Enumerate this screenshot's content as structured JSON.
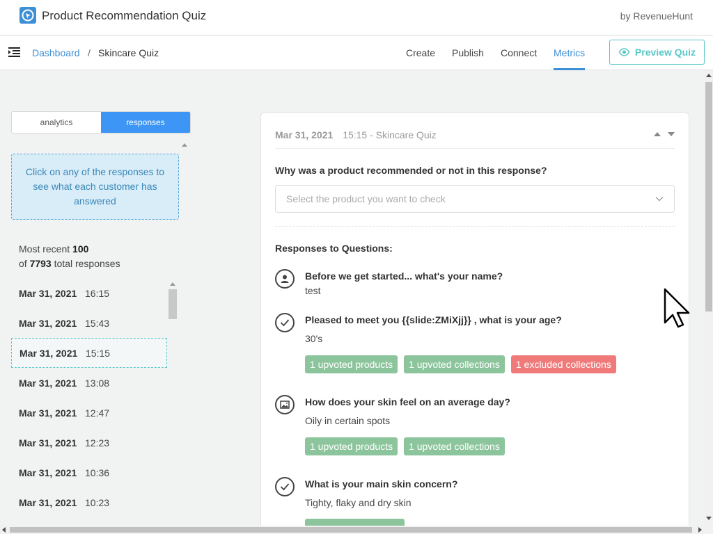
{
  "app": {
    "title": "Product Recommendation Quiz",
    "by": "by RevenueHunt"
  },
  "nav": {
    "breadcrumb_home": "Dashboard",
    "breadcrumb_sep": "/",
    "breadcrumb_current": "Skincare Quiz",
    "tabs": [
      {
        "label": "Create"
      },
      {
        "label": "Publish"
      },
      {
        "label": "Connect"
      },
      {
        "label": "Metrics"
      }
    ],
    "active_tab": "Metrics",
    "preview_label": "Preview Quiz"
  },
  "left": {
    "toggle": {
      "analytics": "analytics",
      "responses": "responses",
      "active": "responses"
    },
    "info": "Click on any of the responses to see what each customer has answered",
    "recent_prefix": "Most recent",
    "recent_count": "100",
    "total_prefix": "of",
    "total_count": "7793",
    "total_suffix": "total responses",
    "responses": [
      {
        "date": "Mar 31, 2021",
        "time": "16:15"
      },
      {
        "date": "Mar 31, 2021",
        "time": "15:43"
      },
      {
        "date": "Mar 31, 2021",
        "time": "15:15"
      },
      {
        "date": "Mar 31, 2021",
        "time": "13:08"
      },
      {
        "date": "Mar 31, 2021",
        "time": "12:47"
      },
      {
        "date": "Mar 31, 2021",
        "time": "12:23"
      },
      {
        "date": "Mar 31, 2021",
        "time": "10:36"
      },
      {
        "date": "Mar 31, 2021",
        "time": "10:23"
      }
    ],
    "selected_index": 2
  },
  "detail": {
    "date": "Mar 31, 2021",
    "subtitle": "15:15 - Skincare Quiz",
    "why_question": "Why was a product recommended or not in this response?",
    "select_placeholder": "Select the product you want to check",
    "responses_title": "Responses to Questions:",
    "qa": [
      {
        "icon": "user-icon",
        "question": "Before we get started... what's your name?",
        "answer": "test",
        "tags": []
      },
      {
        "icon": "check-circle-icon",
        "question": "Pleased to meet you {{slide:ZMiXjj}} , what is your age?",
        "answer": "30's",
        "tags": [
          {
            "label": "1 upvoted products",
            "color": "green"
          },
          {
            "label": "1 upvoted collections",
            "color": "green"
          },
          {
            "label": "1 excluded collections",
            "color": "red"
          }
        ]
      },
      {
        "icon": "image-icon",
        "question": "How does your skin feel on an average day?",
        "answer": "Oily in certain spots",
        "tags": [
          {
            "label": "1 upvoted products",
            "color": "green"
          },
          {
            "label": "1 upvoted collections",
            "color": "green"
          }
        ]
      },
      {
        "icon": "check-circle-icon",
        "question": "What is your main skin concern?",
        "answer": "Tighty, flaky and dry skin",
        "tags": []
      }
    ]
  }
}
